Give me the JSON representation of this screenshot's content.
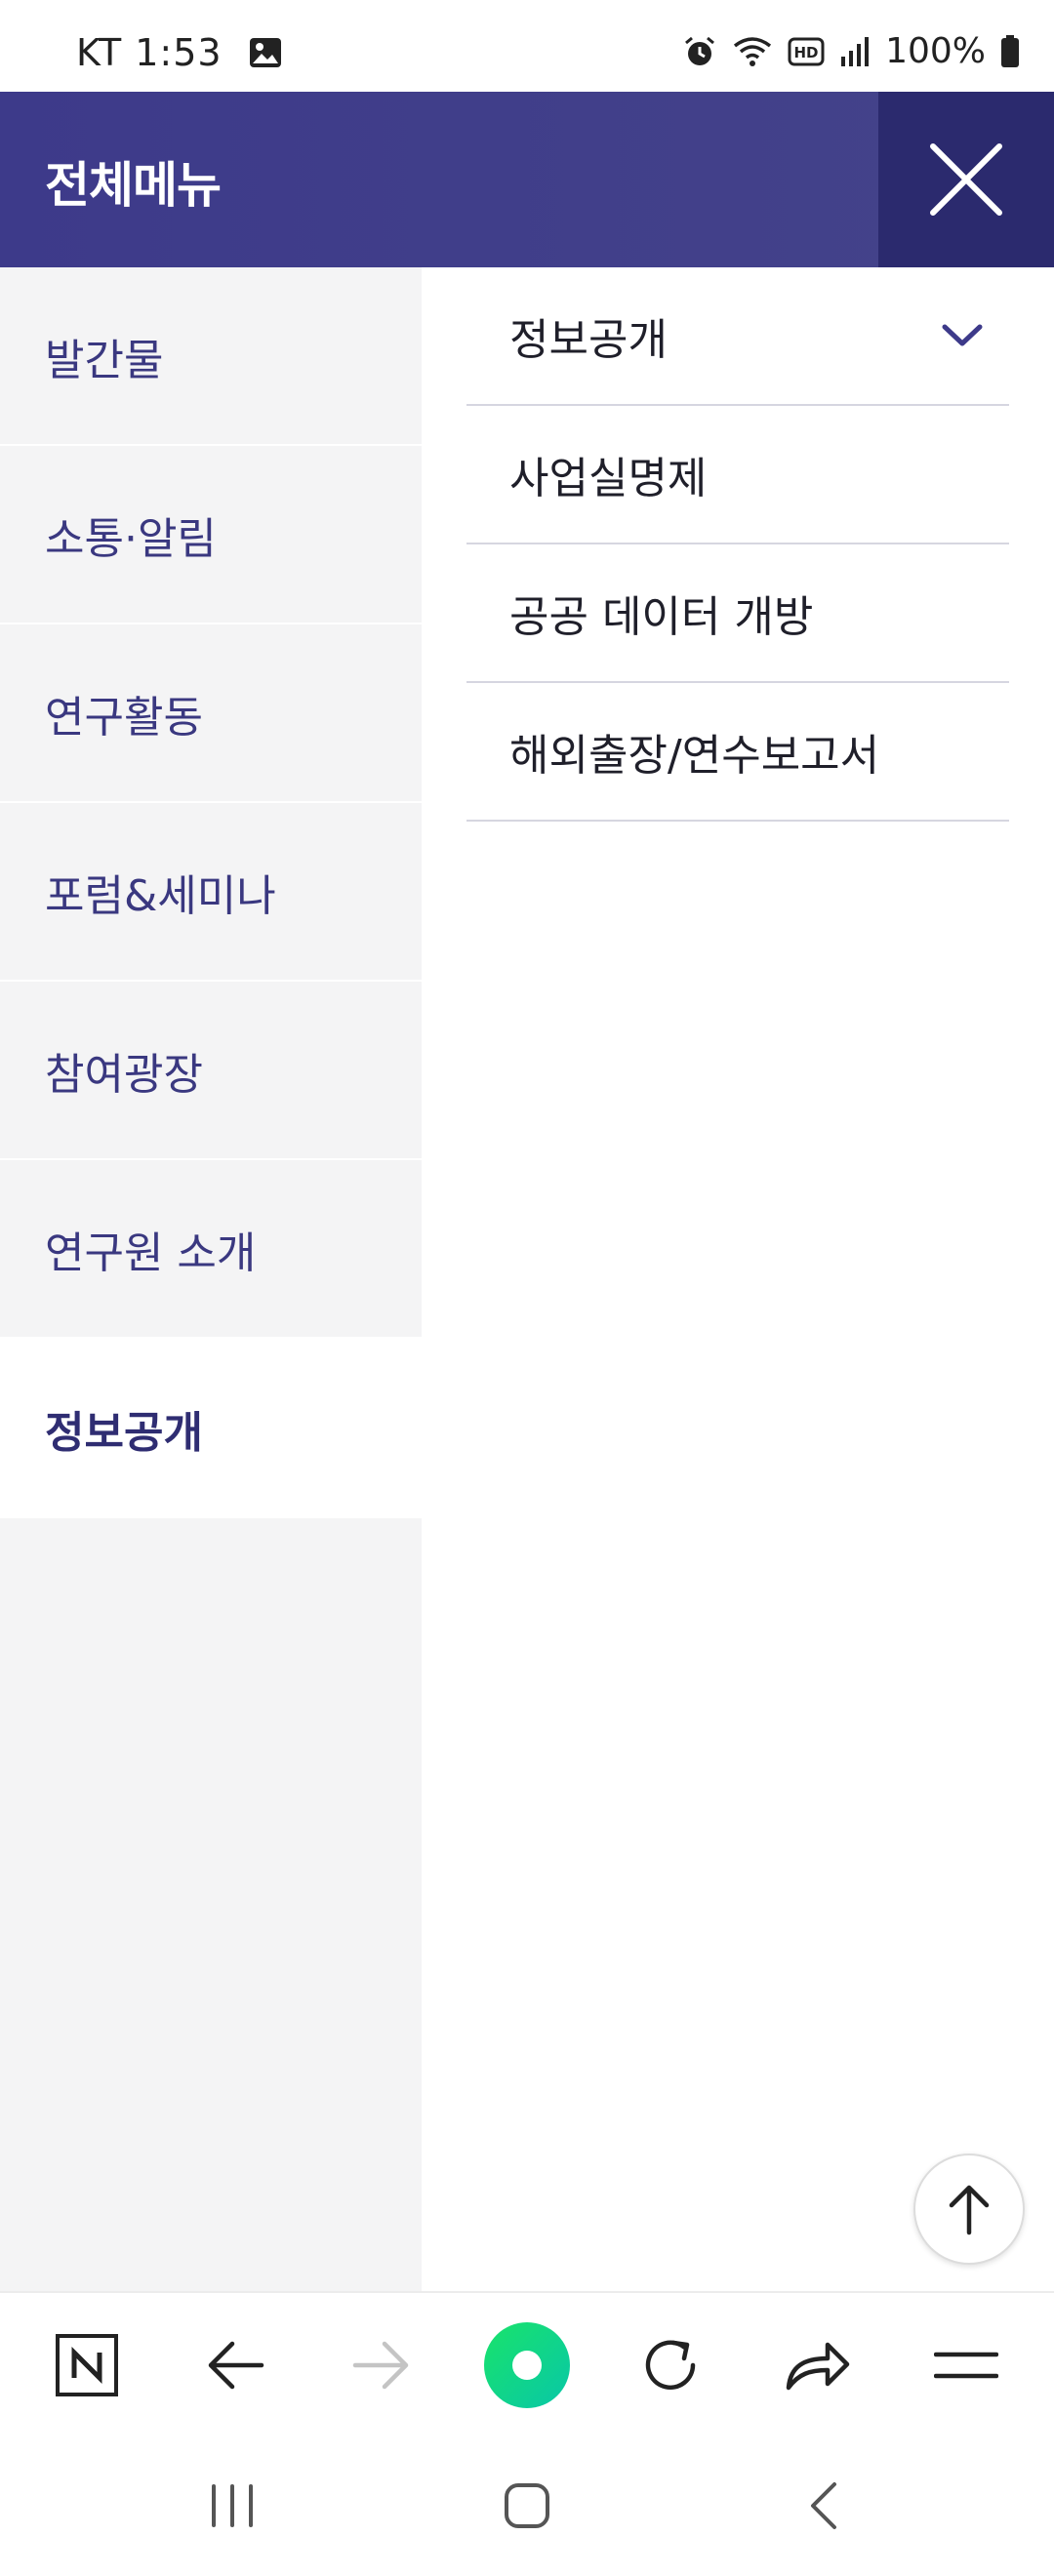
{
  "status_bar": {
    "carrier_time": "KT 1:53",
    "battery": "100%",
    "icons": [
      "image-icon",
      "alarm-icon",
      "wifi-icon",
      "hd-icon",
      "signal-icon",
      "battery-icon"
    ]
  },
  "header": {
    "title": "전체메뉴",
    "close_icon": "close-icon"
  },
  "left_menu": {
    "items": [
      {
        "label": "발간물"
      },
      {
        "label": "소통·알림"
      },
      {
        "label": "연구활동"
      },
      {
        "label": "포럼&세미나"
      },
      {
        "label": "참여광장"
      },
      {
        "label": "연구원 소개"
      },
      {
        "label": "정보공개"
      }
    ],
    "active_index": 6
  },
  "submenu": {
    "items": [
      {
        "label": "정보공개"
      },
      {
        "label": "사업실명제"
      },
      {
        "label": "공공 데이터 개방"
      },
      {
        "label": "해외출장/연수보고서"
      }
    ]
  },
  "browser_toolbar": {
    "icons": [
      "naver-home-icon",
      "back-arrow-icon",
      "forward-arrow-icon",
      "green-dot-icon",
      "refresh-icon",
      "share-icon",
      "menu-icon"
    ]
  },
  "nav_bar": {
    "icons": [
      "recent-apps-icon",
      "home-icon",
      "back-icon"
    ]
  },
  "colors": {
    "header_bg": "#3d3a8a",
    "close_bg": "#2b2a6e",
    "menu_text": "#3a3880",
    "accent_green": "#10d47c"
  }
}
